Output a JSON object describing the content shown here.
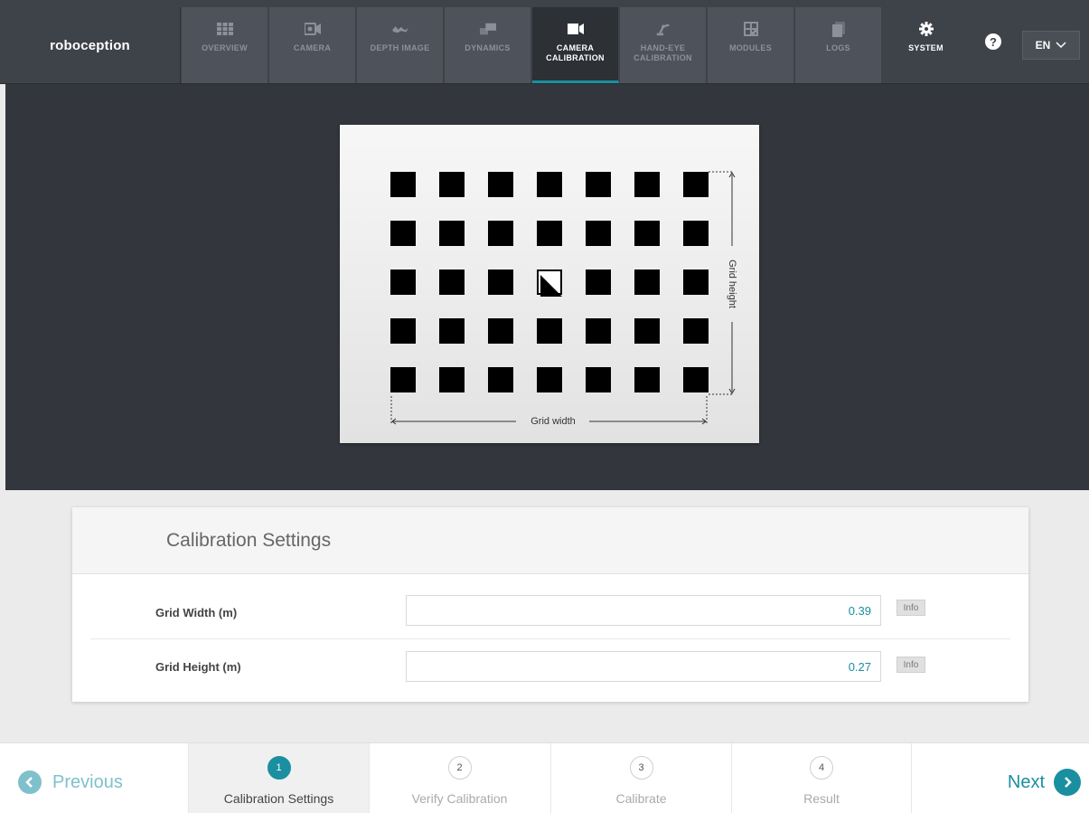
{
  "brand": "roboception",
  "nav": {
    "items": [
      {
        "label": "OVERVIEW",
        "icon": "grid-icon"
      },
      {
        "label": "CAMERA",
        "icon": "camera-icon"
      },
      {
        "label": "DEPTH IMAGE",
        "icon": "depth-icon"
      },
      {
        "label": "DYNAMICS",
        "icon": "dynamics-icon"
      },
      {
        "label": "CAMERA CALIBRATION",
        "icon": "video-camera-icon"
      },
      {
        "label": "HAND-EYE CALIBRATION",
        "icon": "robot-arm-icon"
      },
      {
        "label": "MODULES",
        "icon": "modules-icon"
      },
      {
        "label": "LOGS",
        "icon": "logs-icon"
      },
      {
        "label": "SYSTEM",
        "icon": "gear-icon"
      }
    ],
    "active": "CAMERA CALIBRATION",
    "help": "?",
    "language": "EN"
  },
  "diagram": {
    "grid_height_label": "Grid height",
    "grid_width_label": "Grid width"
  },
  "settings": {
    "title": "Calibration Settings",
    "grid_width_label": "Grid Width (m)",
    "grid_width_value": "0.39",
    "grid_height_label": "Grid Height (m)",
    "grid_height_value": "0.27",
    "info_label": "Info"
  },
  "wizard": {
    "previous": "Previous",
    "next": "Next",
    "steps": [
      {
        "num": "1",
        "label": "Calibration Settings"
      },
      {
        "num": "2",
        "label": "Verify Calibration"
      },
      {
        "num": "3",
        "label": "Calibrate"
      },
      {
        "num": "4",
        "label": "Result"
      }
    ],
    "active_step": 1
  },
  "colors": {
    "accent": "#1a8fa0",
    "nav_bg": "#3e4249",
    "hero_bg": "#33363c"
  }
}
